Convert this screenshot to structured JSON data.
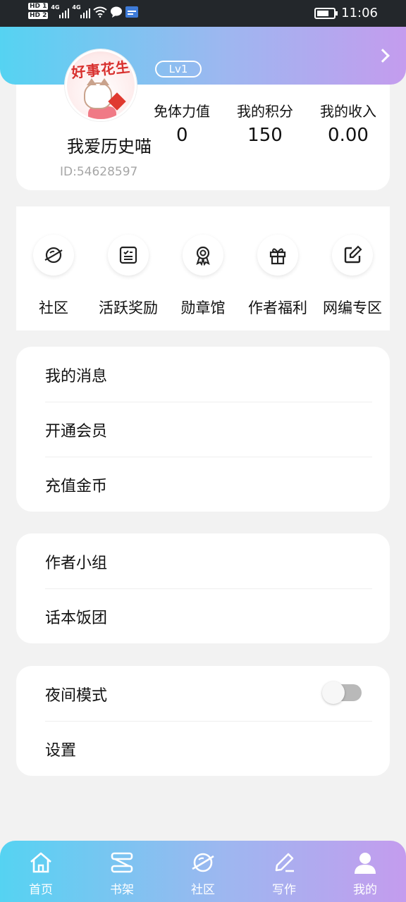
{
  "status_bar": {
    "hd_badges": [
      "HD 1",
      "HD 2"
    ],
    "network": "4G",
    "time": "11:06",
    "icons": [
      "signal-icon",
      "wifi-icon",
      "chat-bubble-icon",
      "app-badge-icon",
      "battery-icon"
    ]
  },
  "profile": {
    "level": "Lv1",
    "avatar_text": "好事花生",
    "username": "我爱历史喵",
    "user_id": "ID:54628597",
    "gender_icon": "female-icon",
    "stats": [
      {
        "label": "免体力值",
        "value": "0"
      },
      {
        "label": "我的积分",
        "value": "150"
      },
      {
        "label": "我的收入",
        "value": "0.00"
      }
    ]
  },
  "quick_actions": [
    {
      "label": "社区",
      "icon": "planet-icon"
    },
    {
      "label": "活跃奖励",
      "icon": "checklist-icon"
    },
    {
      "label": "勋章馆",
      "icon": "medal-icon"
    },
    {
      "label": "作者福利",
      "icon": "gift-icon"
    },
    {
      "label": "网编专区",
      "icon": "edit-icon"
    }
  ],
  "menu_groups": [
    {
      "items": [
        "我的消息",
        "开通会员",
        "充值金币"
      ]
    },
    {
      "items": [
        "作者小组",
        "话本饭团"
      ]
    },
    {
      "items": [
        "夜间模式",
        "设置"
      ],
      "night_mode_on": false
    }
  ],
  "bottom_nav": [
    {
      "label": "首页",
      "icon": "home-icon"
    },
    {
      "label": "书架",
      "icon": "bookshelf-icon"
    },
    {
      "label": "社区",
      "icon": "planet-icon"
    },
    {
      "label": "写作",
      "icon": "pen-icon"
    },
    {
      "label": "我的",
      "icon": "user-icon"
    }
  ],
  "colors": {
    "gradient_start": "#55d3f2",
    "gradient_end": "#c49cee",
    "female_icon": "#e98b90",
    "toggle_off": "#b9b9b9"
  }
}
